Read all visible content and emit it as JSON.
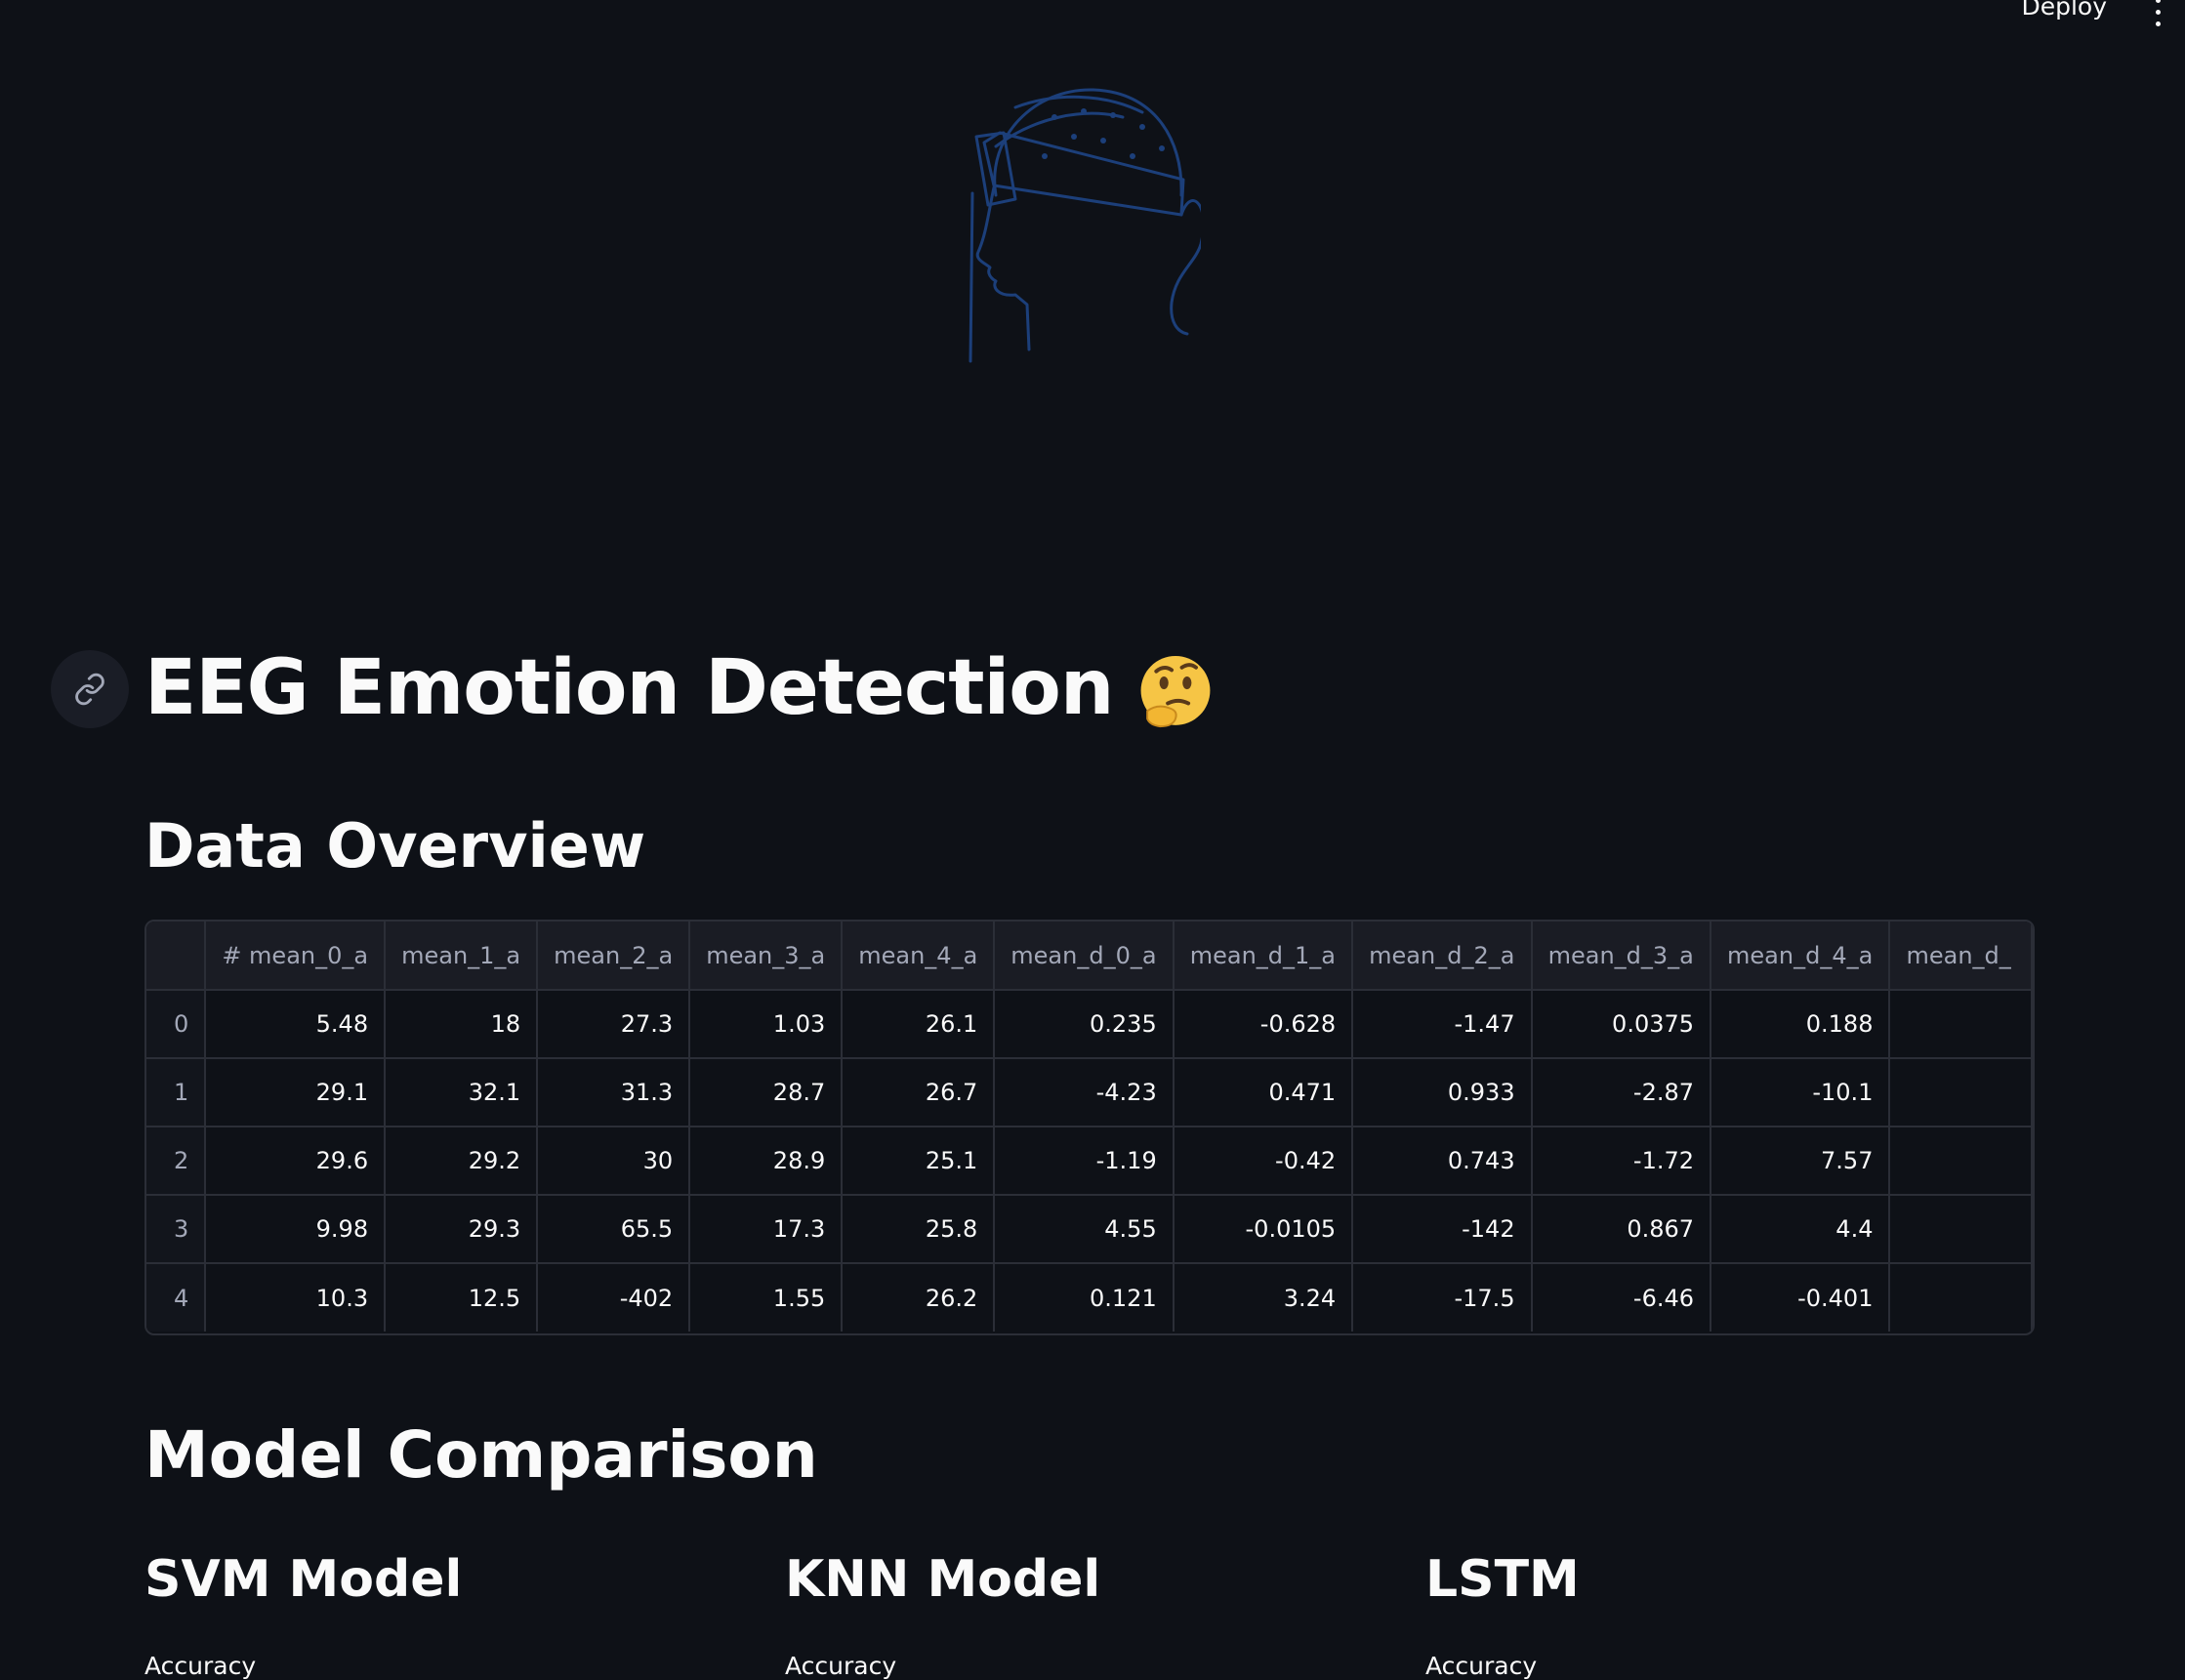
{
  "header": {
    "deploy_label": "Deploy",
    "menu_icon": "more-vertical-icon"
  },
  "hero": {
    "icon": "eeg-headset-head-illustration",
    "color": "#1c3f7a"
  },
  "title": {
    "text": "EEG Emotion Detection",
    "emoji": "🤔",
    "anchor_icon": "link-icon"
  },
  "data_overview": {
    "heading": "Data Overview",
    "columns": [
      "",
      "# mean_0_a",
      "mean_1_a",
      "mean_2_a",
      "mean_3_a",
      "mean_4_a",
      "mean_d_0_a",
      "mean_d_1_a",
      "mean_d_2_a",
      "mean_d_3_a",
      "mean_d_4_a",
      "mean_d_"
    ],
    "rows": [
      [
        "0",
        "5.48",
        "18",
        "27.3",
        "1.03",
        "26.1",
        "0.235",
        "-0.628",
        "-1.47",
        "0.0375",
        "0.188",
        ""
      ],
      [
        "1",
        "29.1",
        "32.1",
        "31.3",
        "28.7",
        "26.7",
        "-4.23",
        "0.471",
        "0.933",
        "-2.87",
        "-10.1",
        ""
      ],
      [
        "2",
        "29.6",
        "29.2",
        "30",
        "28.9",
        "25.1",
        "-1.19",
        "-0.42",
        "0.743",
        "-1.72",
        "7.57",
        ""
      ],
      [
        "3",
        "9.98",
        "29.3",
        "65.5",
        "17.3",
        "25.8",
        "4.55",
        "-0.0105",
        "-142",
        "0.867",
        "4.4",
        ""
      ],
      [
        "4",
        "10.3",
        "12.5",
        "-402",
        "1.55",
        "26.2",
        "0.121",
        "3.24",
        "-17.5",
        "-6.46",
        "-0.401",
        ""
      ]
    ]
  },
  "model_comparison": {
    "heading": "Model Comparison",
    "models": [
      {
        "name": "SVM Model",
        "metric_label": "Accuracy"
      },
      {
        "name": "KNN Model",
        "metric_label": "Accuracy"
      },
      {
        "name": "LSTM",
        "metric_label": "Accuracy"
      }
    ]
  }
}
